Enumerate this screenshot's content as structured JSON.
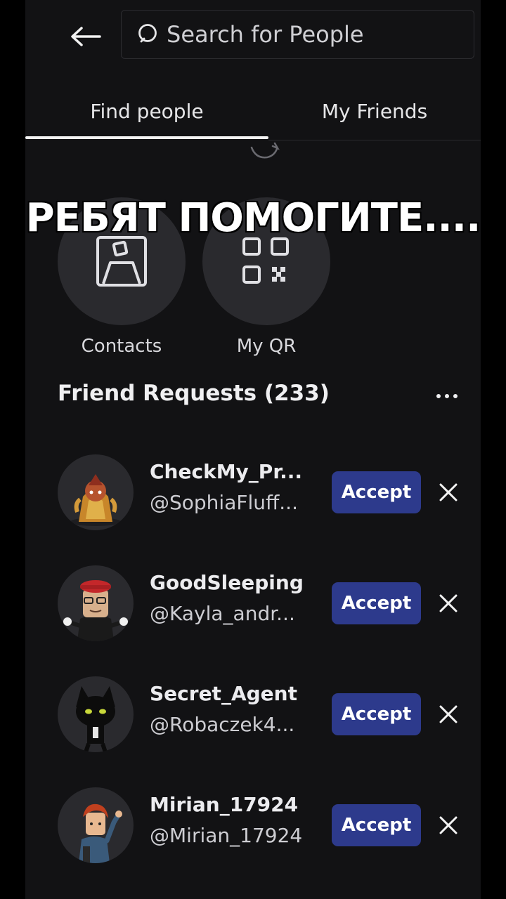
{
  "header": {
    "back_icon": "back-arrow-icon",
    "search": {
      "placeholder": "Search for People",
      "icon": "search-icon"
    }
  },
  "tabs": [
    {
      "label": "Find people",
      "active": true
    },
    {
      "label": "My Friends",
      "active": false
    }
  ],
  "quick_actions": [
    {
      "label": "Contacts",
      "icon": "contacts-icon"
    },
    {
      "label": "My QR",
      "icon": "qr-code-icon"
    }
  ],
  "overlay_caption": "РЕБЯТ ПОМОГИТЕ....",
  "friend_requests": {
    "title": "Friend Requests (233)",
    "more_icon": "more-options-icon",
    "items": [
      {
        "name": "CheckMy_Pr...",
        "handle": "@SophiaFluff...",
        "accept_label": "Accept"
      },
      {
        "name": "GoodSleeping",
        "handle": "@Kayla_andr...",
        "accept_label": "Accept"
      },
      {
        "name": "Secret_Agent",
        "handle": "@Robaczek4...",
        "accept_label": "Accept"
      },
      {
        "name": "Mirian_17924",
        "handle": "@Mirian_17924",
        "accept_label": "Accept"
      }
    ]
  },
  "colors": {
    "background": "#121214",
    "accent_button": "#2d3a8c",
    "circle": "#2a2a2e"
  }
}
